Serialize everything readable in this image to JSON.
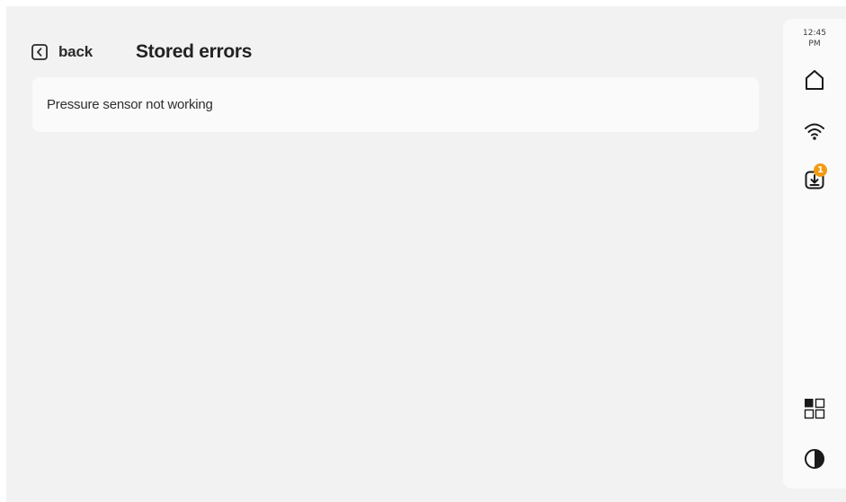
{
  "header": {
    "back_label": "back",
    "title": "Stored errors"
  },
  "errors": [
    {
      "text": "Pressure sensor not working"
    }
  ],
  "sidebar": {
    "time": "12:45",
    "ampm": "PM",
    "icons": [
      "home-icon",
      "wifi-icon",
      "download-icon",
      "apps-grid-icon",
      "contrast-icon"
    ],
    "download_badge": "1"
  },
  "colors": {
    "background": "#f2f2f2",
    "card": "#fafafa",
    "badge": "#f29a12",
    "text": "#222222"
  }
}
